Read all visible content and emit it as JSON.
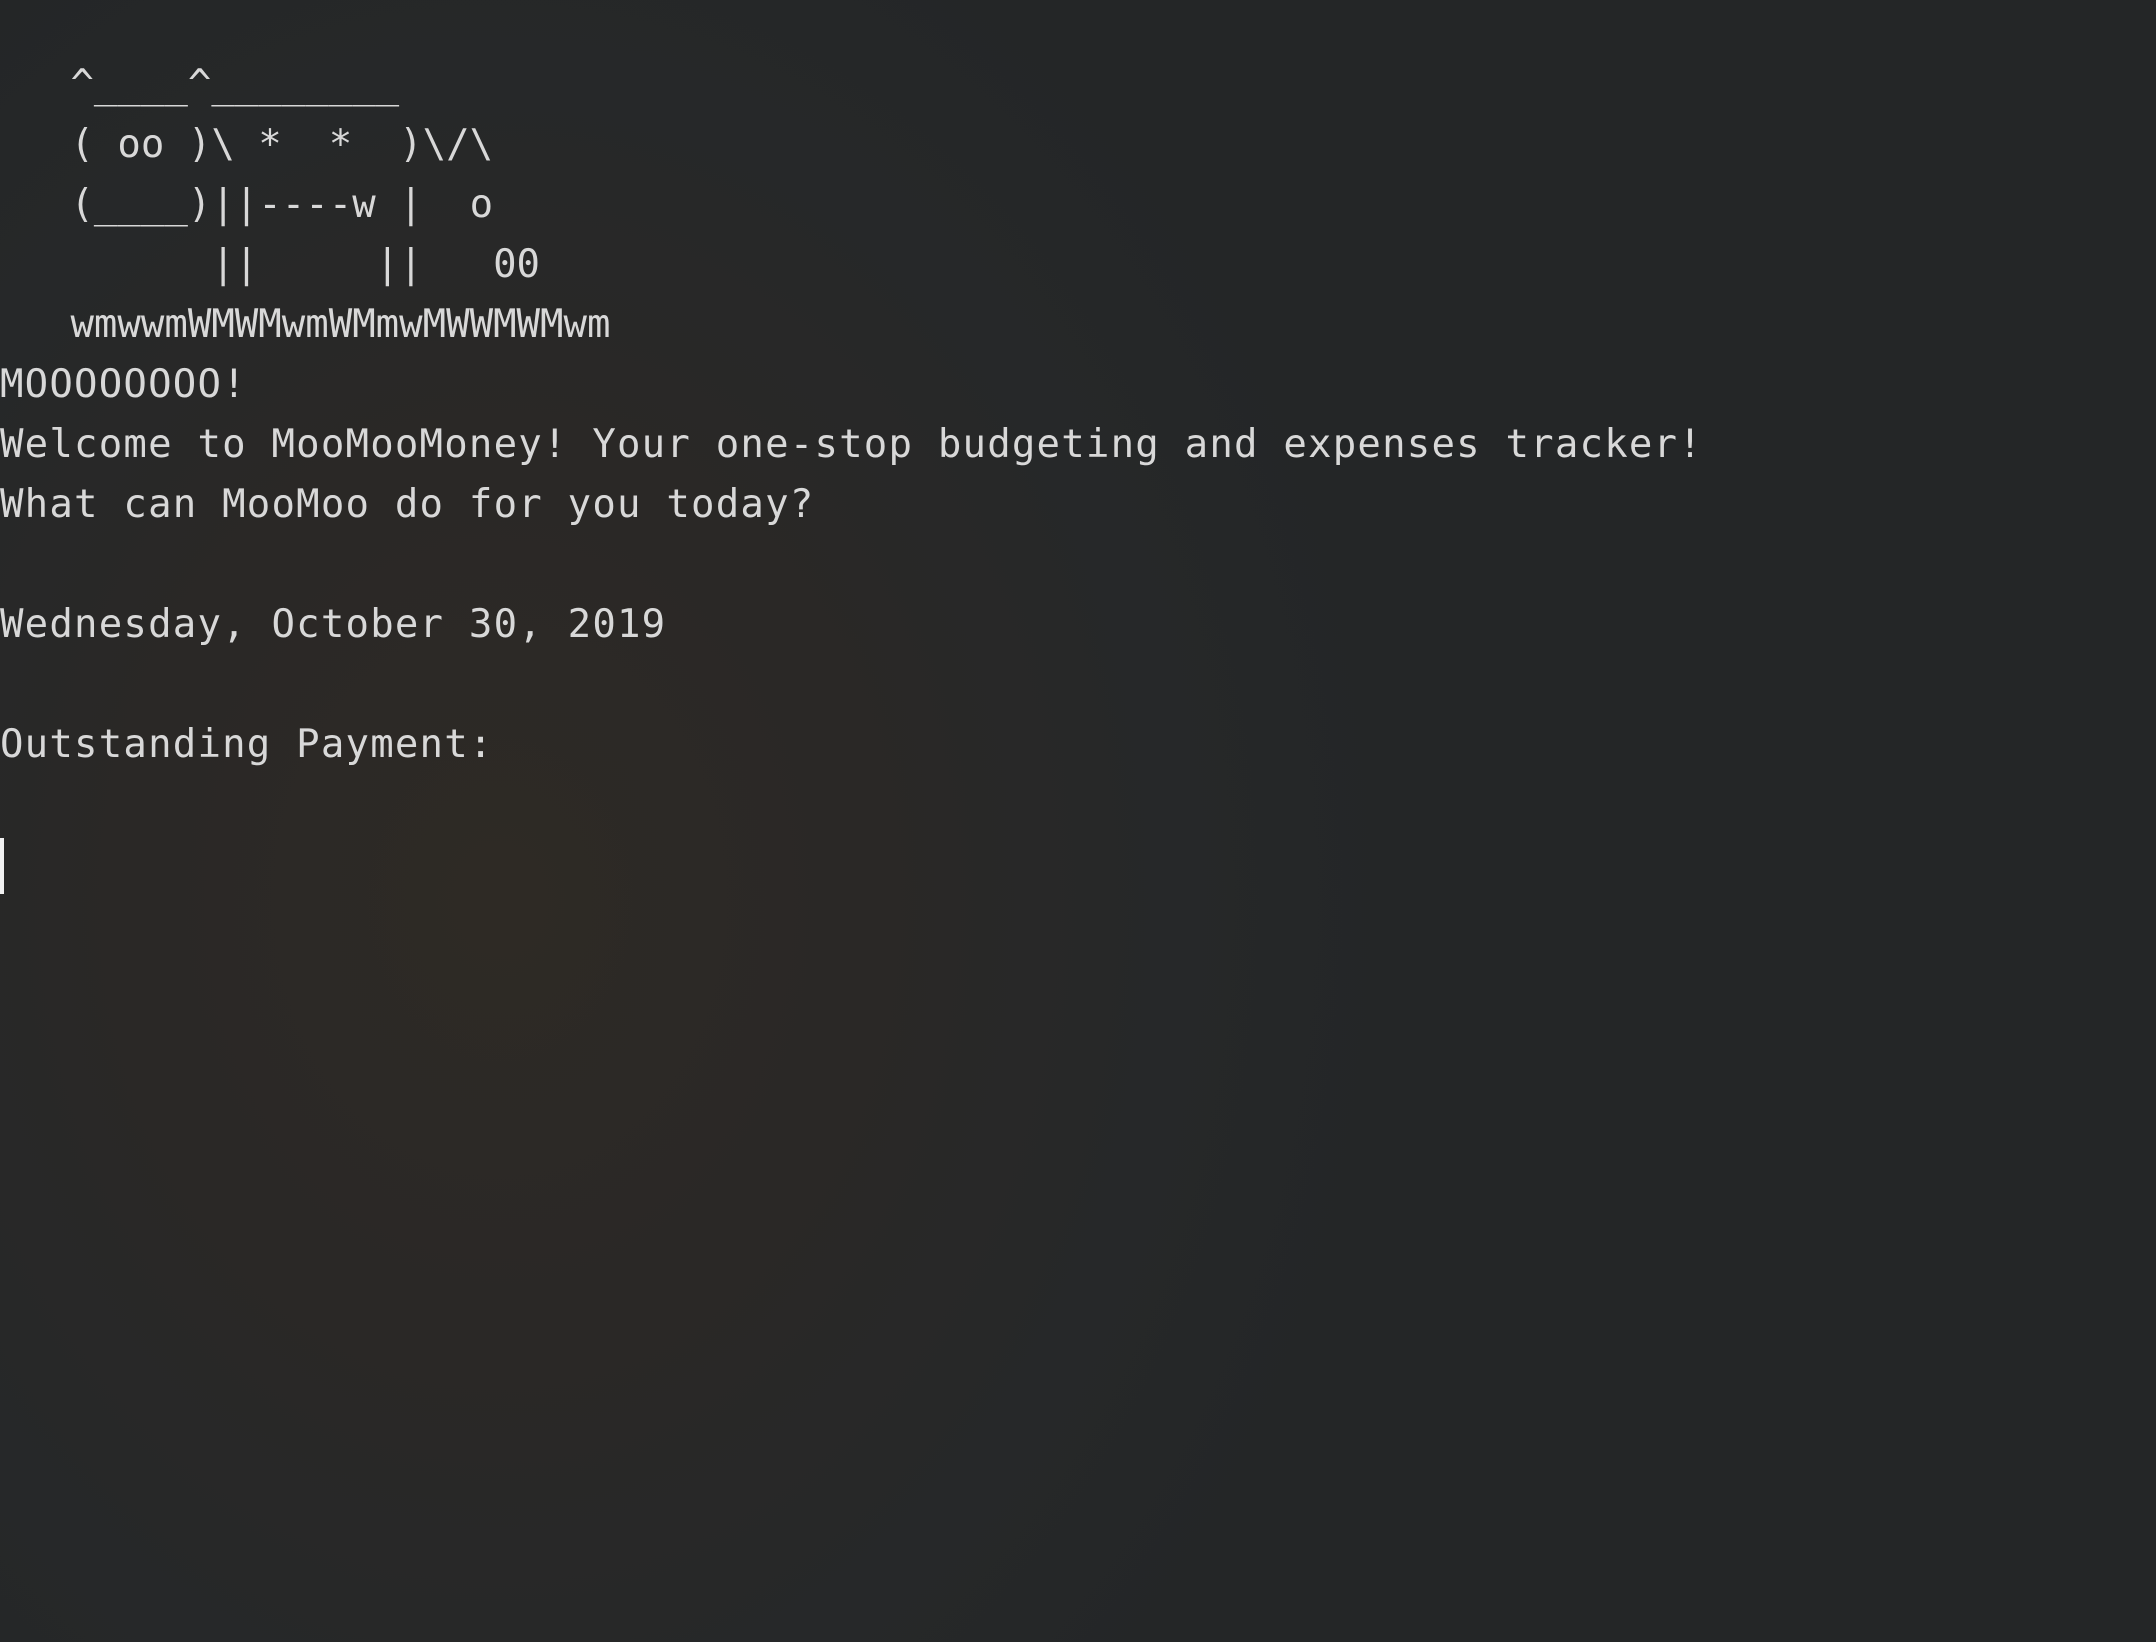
{
  "terminal": {
    "ascii_art": [
      "   ^____^________",
      "   ( oo )\\ *  *  )\\/\\",
      "   (____)||----w |  o",
      "         ||     ||   00",
      "   wmwwmWMWMwmWMmwMWWMWMwm"
    ],
    "greeting": "MOOOOOOOO!",
    "welcome": "Welcome to MooMooMoney! Your one-stop budgeting and expenses tracker!",
    "prompt": "What can MooMoo do for you today?",
    "date": "Wednesday, October 30, 2019",
    "outstanding_label": "Outstanding Payment:"
  }
}
